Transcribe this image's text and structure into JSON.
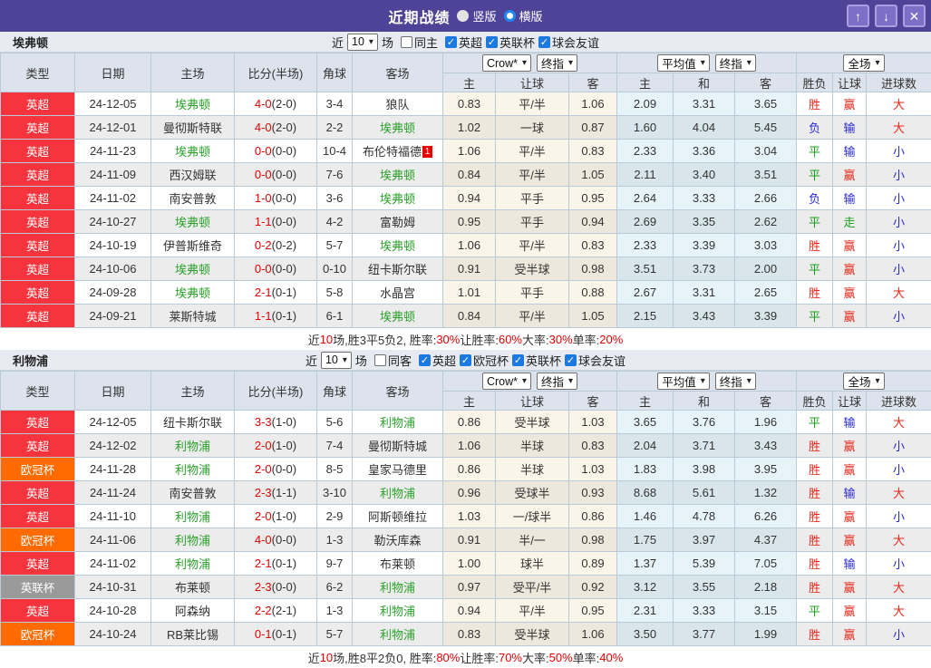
{
  "titlebar": {
    "title": "近期战绩",
    "radios": [
      {
        "label": "竖版",
        "checked": false
      },
      {
        "label": "横版",
        "checked": true
      }
    ],
    "buttons": {
      "up": "↑",
      "down": "↓",
      "close": "✕"
    }
  },
  "table_header": {
    "cols": [
      "类型",
      "日期",
      "主场",
      "比分(半场)",
      "角球",
      "客场"
    ],
    "group1_selects": [
      "Crow*",
      "终指"
    ],
    "group2_selects": [
      "平均值",
      "终指"
    ],
    "group3_selects": [
      "全场"
    ],
    "sub": [
      "主",
      "让球",
      "客",
      "主",
      "和",
      "客",
      "胜负",
      "让球",
      "进球数"
    ]
  },
  "league_classes": {
    "英超": "lg-epl",
    "欧冠杯": "lg-ucl",
    "英联杯": "lg-efl"
  },
  "result_classes": {
    "胜": "c-win",
    "平": "c-draw",
    "负": "c-loss",
    "赢": "c-win",
    "输": "c-loss",
    "走": "c-draw",
    "大": "c-win",
    "小": "c-loss"
  },
  "colors": {
    "titlebar": "#4f4398",
    "epl_red": "#f5343e",
    "ucl_orange": "#ff6b00",
    "efl_gray": "#9a9a9a",
    "team_green": "#2ba12b",
    "score_red": "#e60000",
    "win_red": "#e8291c",
    "draw_green": "#1a9e1a",
    "loss_blue": "#2929d4"
  },
  "sections": [
    {
      "team": "埃弗顿",
      "filter": {
        "prefix": "近",
        "count": "10",
        "suffix": "场",
        "same_label": "同主",
        "same_checked": false,
        "leagues": [
          "英超",
          "英联杯",
          "球会友谊"
        ]
      },
      "rows": [
        {
          "league": "英超",
          "date": "24-12-05",
          "home": "埃弗顿",
          "home_team": true,
          "score": "4-0",
          "half": "(2-0)",
          "corners": "3-4",
          "away": "狼队",
          "away_team": false,
          "badge": "",
          "o_home": "0.83",
          "o_line": "平/半",
          "o_away": "1.06",
          "avg_home": "2.09",
          "avg_draw": "3.31",
          "avg_away": "3.65",
          "res_outcome": "胜",
          "res_handicap": "赢",
          "res_goals": "大"
        },
        {
          "league": "英超",
          "date": "24-12-01",
          "home": "曼彻斯特联",
          "home_team": false,
          "score": "4-0",
          "half": "(2-0)",
          "corners": "2-2",
          "away": "埃弗顿",
          "away_team": true,
          "badge": "",
          "o_home": "1.02",
          "o_line": "一球",
          "o_away": "0.87",
          "avg_home": "1.60",
          "avg_draw": "4.04",
          "avg_away": "5.45",
          "res_outcome": "负",
          "res_handicap": "输",
          "res_goals": "大"
        },
        {
          "league": "英超",
          "date": "24-11-23",
          "home": "埃弗顿",
          "home_team": true,
          "score": "0-0",
          "half": "(0-0)",
          "corners": "10-4",
          "away": "布伦特福德",
          "away_team": false,
          "badge": "1",
          "o_home": "1.06",
          "o_line": "平/半",
          "o_away": "0.83",
          "avg_home": "2.33",
          "avg_draw": "3.36",
          "avg_away": "3.04",
          "res_outcome": "平",
          "res_handicap": "输",
          "res_goals": "小"
        },
        {
          "league": "英超",
          "date": "24-11-09",
          "home": "西汉姆联",
          "home_team": false,
          "score": "0-0",
          "half": "(0-0)",
          "corners": "7-6",
          "away": "埃弗顿",
          "away_team": true,
          "badge": "",
          "o_home": "0.84",
          "o_line": "平/半",
          "o_away": "1.05",
          "avg_home": "2.11",
          "avg_draw": "3.40",
          "avg_away": "3.51",
          "res_outcome": "平",
          "res_handicap": "赢",
          "res_goals": "小"
        },
        {
          "league": "英超",
          "date": "24-11-02",
          "home": "南安普敦",
          "home_team": false,
          "score": "1-0",
          "half": "(0-0)",
          "corners": "3-6",
          "away": "埃弗顿",
          "away_team": true,
          "badge": "",
          "o_home": "0.94",
          "o_line": "平手",
          "o_away": "0.95",
          "avg_home": "2.64",
          "avg_draw": "3.33",
          "avg_away": "2.66",
          "res_outcome": "负",
          "res_handicap": "输",
          "res_goals": "小"
        },
        {
          "league": "英超",
          "date": "24-10-27",
          "home": "埃弗顿",
          "home_team": true,
          "score": "1-1",
          "half": "(0-0)",
          "corners": "4-2",
          "away": "富勒姆",
          "away_team": false,
          "badge": "",
          "o_home": "0.95",
          "o_line": "平手",
          "o_away": "0.94",
          "avg_home": "2.69",
          "avg_draw": "3.35",
          "avg_away": "2.62",
          "res_outcome": "平",
          "res_handicap": "走",
          "res_goals": "小"
        },
        {
          "league": "英超",
          "date": "24-10-19",
          "home": "伊普斯维奇",
          "home_team": false,
          "score": "0-2",
          "half": "(0-2)",
          "corners": "5-7",
          "away": "埃弗顿",
          "away_team": true,
          "badge": "",
          "o_home": "1.06",
          "o_line": "平/半",
          "o_away": "0.83",
          "avg_home": "2.33",
          "avg_draw": "3.39",
          "avg_away": "3.03",
          "res_outcome": "胜",
          "res_handicap": "赢",
          "res_goals": "小"
        },
        {
          "league": "英超",
          "date": "24-10-06",
          "home": "埃弗顿",
          "home_team": true,
          "score": "0-0",
          "half": "(0-0)",
          "corners": "0-10",
          "away": "纽卡斯尔联",
          "away_team": false,
          "badge": "",
          "o_home": "0.91",
          "o_line": "受半球",
          "o_away": "0.98",
          "avg_home": "3.51",
          "avg_draw": "3.73",
          "avg_away": "2.00",
          "res_outcome": "平",
          "res_handicap": "赢",
          "res_goals": "小"
        },
        {
          "league": "英超",
          "date": "24-09-28",
          "home": "埃弗顿",
          "home_team": true,
          "score": "2-1",
          "half": "(0-1)",
          "corners": "5-8",
          "away": "水晶宫",
          "away_team": false,
          "badge": "",
          "o_home": "1.01",
          "o_line": "平手",
          "o_away": "0.88",
          "avg_home": "2.67",
          "avg_draw": "3.31",
          "avg_away": "2.65",
          "res_outcome": "胜",
          "res_handicap": "赢",
          "res_goals": "大"
        },
        {
          "league": "英超",
          "date": "24-09-21",
          "home": "莱斯特城",
          "home_team": false,
          "score": "1-1",
          "half": "(0-1)",
          "corners": "6-1",
          "away": "埃弗顿",
          "away_team": true,
          "badge": "",
          "o_home": "0.84",
          "o_line": "平/半",
          "o_away": "1.05",
          "avg_home": "2.15",
          "avg_draw": "3.43",
          "avg_away": "3.39",
          "res_outcome": "平",
          "res_handicap": "赢",
          "res_goals": "小"
        }
      ],
      "summary": [
        "近",
        "10",
        "场,胜3平5负2, 胜率:",
        "30%",
        " 让胜率:",
        "60%",
        " 大率:",
        "30%",
        " 单率:",
        "20%"
      ]
    },
    {
      "team": "利物浦",
      "filter": {
        "prefix": "近",
        "count": "10",
        "suffix": "场",
        "same_label": "同客",
        "same_checked": false,
        "leagues": [
          "英超",
          "欧冠杯",
          "英联杯",
          "球会友谊"
        ]
      },
      "rows": [
        {
          "league": "英超",
          "date": "24-12-05",
          "home": "纽卡斯尔联",
          "home_team": false,
          "score": "3-3",
          "half": "(1-0)",
          "corners": "5-6",
          "away": "利物浦",
          "away_team": true,
          "badge": "",
          "o_home": "0.86",
          "o_line": "受半球",
          "o_away": "1.03",
          "avg_home": "3.65",
          "avg_draw": "3.76",
          "avg_away": "1.96",
          "res_outcome": "平",
          "res_handicap": "输",
          "res_goals": "大"
        },
        {
          "league": "英超",
          "date": "24-12-02",
          "home": "利物浦",
          "home_team": true,
          "score": "2-0",
          "half": "(1-0)",
          "corners": "7-4",
          "away": "曼彻斯特城",
          "away_team": false,
          "badge": "",
          "o_home": "1.06",
          "o_line": "半球",
          "o_away": "0.83",
          "avg_home": "2.04",
          "avg_draw": "3.71",
          "avg_away": "3.43",
          "res_outcome": "胜",
          "res_handicap": "赢",
          "res_goals": "小"
        },
        {
          "league": "欧冠杯",
          "date": "24-11-28",
          "home": "利物浦",
          "home_team": true,
          "score": "2-0",
          "half": "(0-0)",
          "corners": "8-5",
          "away": "皇家马德里",
          "away_team": false,
          "badge": "",
          "o_home": "0.86",
          "o_line": "半球",
          "o_away": "1.03",
          "avg_home": "1.83",
          "avg_draw": "3.98",
          "avg_away": "3.95",
          "res_outcome": "胜",
          "res_handicap": "赢",
          "res_goals": "小"
        },
        {
          "league": "英超",
          "date": "24-11-24",
          "home": "南安普敦",
          "home_team": false,
          "score": "2-3",
          "half": "(1-1)",
          "corners": "3-10",
          "away": "利物浦",
          "away_team": true,
          "badge": "",
          "o_home": "0.96",
          "o_line": "受球半",
          "o_away": "0.93",
          "avg_home": "8.68",
          "avg_draw": "5.61",
          "avg_away": "1.32",
          "res_outcome": "胜",
          "res_handicap": "输",
          "res_goals": "大"
        },
        {
          "league": "英超",
          "date": "24-11-10",
          "home": "利物浦",
          "home_team": true,
          "score": "2-0",
          "half": "(1-0)",
          "corners": "2-9",
          "away": "阿斯顿维拉",
          "away_team": false,
          "badge": "",
          "o_home": "1.03",
          "o_line": "一/球半",
          "o_away": "0.86",
          "avg_home": "1.46",
          "avg_draw": "4.78",
          "avg_away": "6.26",
          "res_outcome": "胜",
          "res_handicap": "赢",
          "res_goals": "小"
        },
        {
          "league": "欧冠杯",
          "date": "24-11-06",
          "home": "利物浦",
          "home_team": true,
          "score": "4-0",
          "half": "(0-0)",
          "corners": "1-3",
          "away": "勒沃库森",
          "away_team": false,
          "badge": "",
          "o_home": "0.91",
          "o_line": "半/一",
          "o_away": "0.98",
          "avg_home": "1.75",
          "avg_draw": "3.97",
          "avg_away": "4.37",
          "res_outcome": "胜",
          "res_handicap": "赢",
          "res_goals": "大"
        },
        {
          "league": "英超",
          "date": "24-11-02",
          "home": "利物浦",
          "home_team": true,
          "score": "2-1",
          "half": "(0-1)",
          "corners": "9-7",
          "away": "布莱顿",
          "away_team": false,
          "badge": "",
          "o_home": "1.00",
          "o_line": "球半",
          "o_away": "0.89",
          "avg_home": "1.37",
          "avg_draw": "5.39",
          "avg_away": "7.05",
          "res_outcome": "胜",
          "res_handicap": "输",
          "res_goals": "小"
        },
        {
          "league": "英联杯",
          "date": "24-10-31",
          "home": "布莱顿",
          "home_team": false,
          "score": "2-3",
          "half": "(0-0)",
          "corners": "6-2",
          "away": "利物浦",
          "away_team": true,
          "badge": "",
          "o_home": "0.97",
          "o_line": "受平/半",
          "o_away": "0.92",
          "avg_home": "3.12",
          "avg_draw": "3.55",
          "avg_away": "2.18",
          "res_outcome": "胜",
          "res_handicap": "赢",
          "res_goals": "大"
        },
        {
          "league": "英超",
          "date": "24-10-28",
          "home": "阿森纳",
          "home_team": false,
          "score": "2-2",
          "half": "(2-1)",
          "corners": "1-3",
          "away": "利物浦",
          "away_team": true,
          "badge": "",
          "o_home": "0.94",
          "o_line": "平/半",
          "o_away": "0.95",
          "avg_home": "2.31",
          "avg_draw": "3.33",
          "avg_away": "3.15",
          "res_outcome": "平",
          "res_handicap": "赢",
          "res_goals": "大"
        },
        {
          "league": "欧冠杯",
          "date": "24-10-24",
          "home": "RB莱比锡",
          "home_team": false,
          "score": "0-1",
          "half": "(0-1)",
          "corners": "5-7",
          "away": "利物浦",
          "away_team": true,
          "badge": "",
          "o_home": "0.83",
          "o_line": "受半球",
          "o_away": "1.06",
          "avg_home": "3.50",
          "avg_draw": "3.77",
          "avg_away": "1.99",
          "res_outcome": "胜",
          "res_handicap": "赢",
          "res_goals": "小"
        }
      ],
      "summary": [
        "近",
        "10",
        "场,胜8平2负0, 胜率:",
        "80%",
        " 让胜率:",
        "70%",
        " 大率:",
        "50%",
        " 单率:",
        "40%"
      ]
    }
  ]
}
